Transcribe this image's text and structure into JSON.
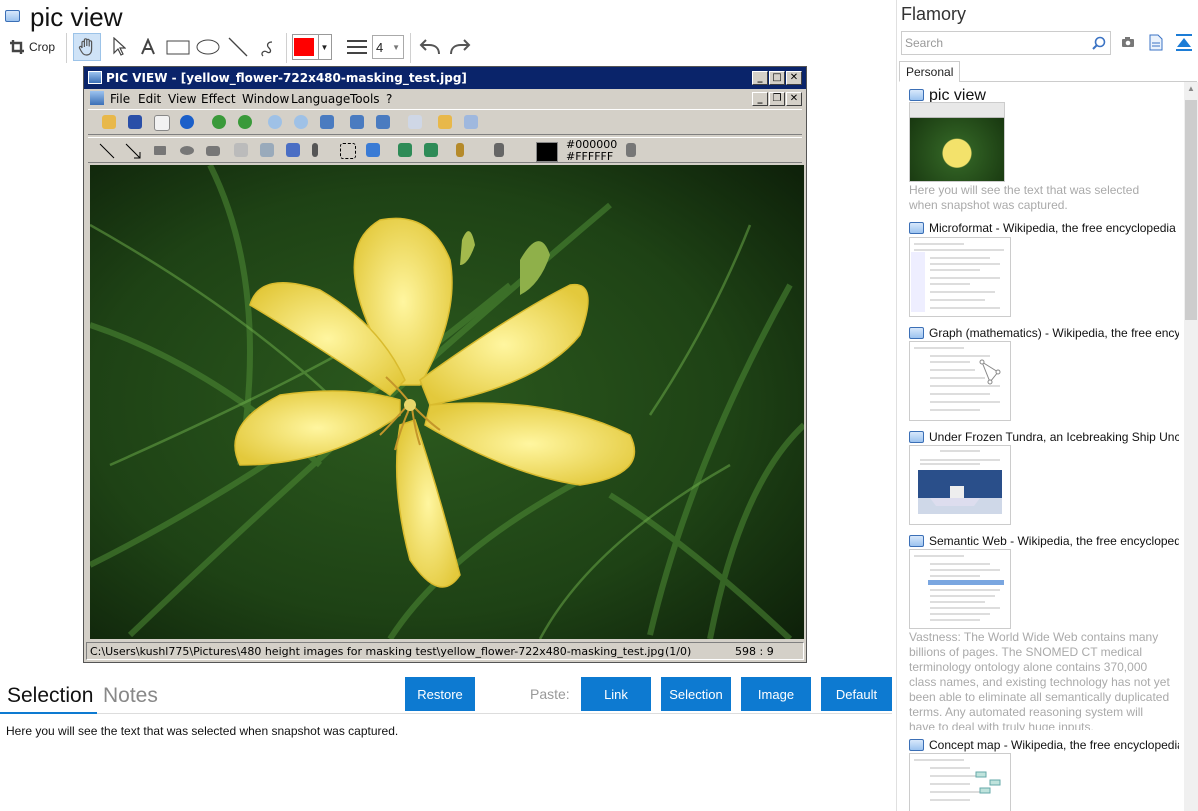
{
  "app": {
    "title": "pic view",
    "crop_label": "Crop",
    "line_width": "4",
    "color_swatch": "#ff0000"
  },
  "screenshot": {
    "window_title": "PIC VIEW  - [yellow_flower-722x480-masking_test.jpg]",
    "menu": [
      "File",
      "Edit",
      "View",
      "Effect",
      "Window",
      "Language",
      "Tools",
      "?"
    ],
    "fg_color_hex": "#000000",
    "bg_color_hex": "#FFFFFF",
    "status_path": "C:\\Users\\kushl775\\Pictures\\480 height images for masking test\\yellow_flower-722x480-masking_test.jpg",
    "status_page": "(1/0)",
    "status_coords": "598 : 9"
  },
  "bottom": {
    "tab_selection": "Selection",
    "tab_notes": "Notes",
    "restore_label": "Restore",
    "paste_label": "Paste:",
    "paste_buttons": {
      "link": "Link",
      "selection": "Selection",
      "image": "Image",
      "default": "Default"
    },
    "selection_text": "Here you will see the text that was selected when snapshot was captured."
  },
  "sidebar": {
    "brand": "Flamory",
    "search_placeholder": "Search",
    "tab_personal": "Personal",
    "items": [
      {
        "title": "pic view",
        "text": "Here you will see the text that was selected when snapshot was captured."
      },
      {
        "title": "Microformat - Wikipedia, the free encyclopedia"
      },
      {
        "title": "Graph (mathematics) - Wikipedia, the free ency"
      },
      {
        "title": "Under Frozen Tundra, an Icebreaking Ship Unco"
      },
      {
        "title": "Semantic Web - Wikipedia, the free encycloped",
        "text": "Vastness: The World Wide Web contains many billions of pages. The SNOMED CT medical terminology ontology alone contains 370,000 class names, and existing technology has not yet been able to eliminate all semantically duplicated terms. Any automated reasoning system will have to deal with truly huge inputs."
      },
      {
        "title": "Concept map - Wikipedia, the free encyclopedia"
      }
    ]
  }
}
